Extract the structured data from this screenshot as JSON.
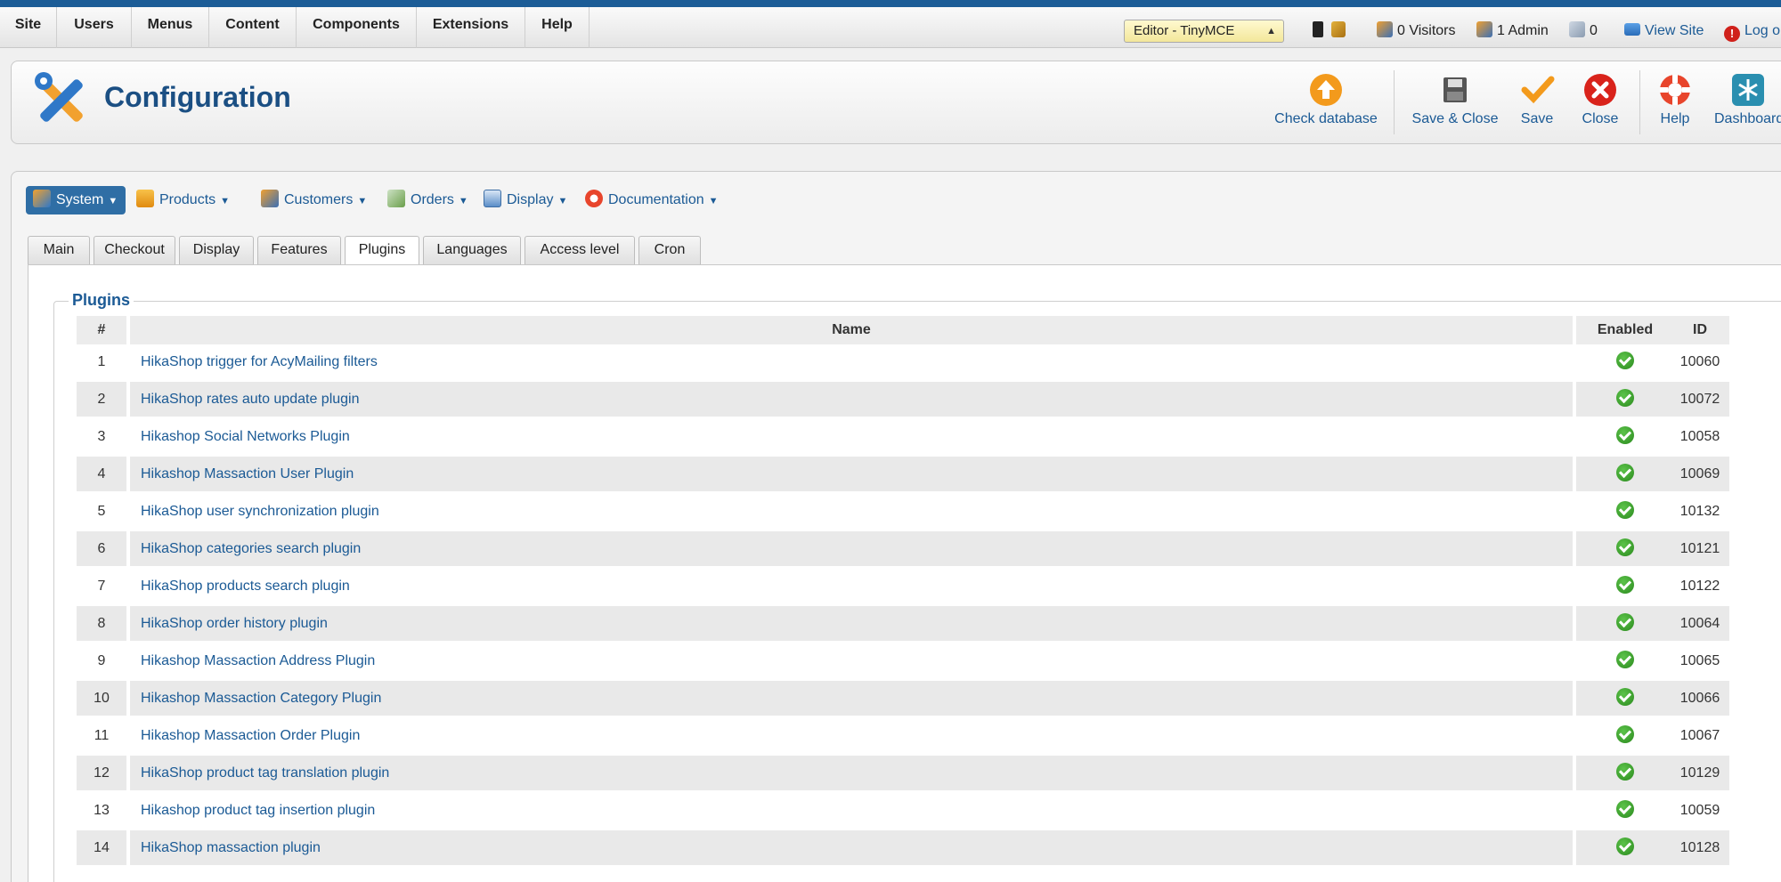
{
  "menubar": {
    "items": [
      "Site",
      "Users",
      "Menus",
      "Content",
      "Components",
      "Extensions",
      "Help"
    ],
    "editor": "Editor - TinyMCE",
    "visitors": "0 Visitors",
    "admins": "1 Admin",
    "messages": "0",
    "view_site": "View Site",
    "logout": "Log out"
  },
  "header": {
    "title": "Configuration",
    "toolbar": {
      "check_database": "Check database",
      "save_close": "Save & Close",
      "save": "Save",
      "close": "Close",
      "help": "Help",
      "dashboard": "Dashboard"
    }
  },
  "submenu": {
    "system": "System",
    "products": "Products",
    "customers": "Customers",
    "orders": "Orders",
    "display": "Display",
    "documentation": "Documentation"
  },
  "tabs": [
    "Main",
    "Checkout",
    "Display",
    "Features",
    "Plugins",
    "Languages",
    "Access level",
    "Cron"
  ],
  "active_tab": "Plugins",
  "plugins": {
    "legend": "Plugins",
    "columns": {
      "num": "#",
      "name": "Name",
      "enabled": "Enabled",
      "id": "ID"
    },
    "rows": [
      {
        "num": "1",
        "name": "HikaShop trigger for AcyMailing filters",
        "id": "10060"
      },
      {
        "num": "2",
        "name": "HikaShop rates auto update plugin",
        "id": "10072"
      },
      {
        "num": "3",
        "name": "Hikashop Social Networks Plugin",
        "id": "10058"
      },
      {
        "num": "4",
        "name": "Hikashop Massaction User Plugin",
        "id": "10069"
      },
      {
        "num": "5",
        "name": "HikaShop user synchronization plugin",
        "id": "10132"
      },
      {
        "num": "6",
        "name": "HikaShop categories search plugin",
        "id": "10121"
      },
      {
        "num": "7",
        "name": "HikaShop products search plugin",
        "id": "10122"
      },
      {
        "num": "8",
        "name": "HikaShop order history plugin",
        "id": "10064"
      },
      {
        "num": "9",
        "name": "Hikashop Massaction Address Plugin",
        "id": "10065"
      },
      {
        "num": "10",
        "name": "Hikashop Massaction Category Plugin",
        "id": "10066"
      },
      {
        "num": "11",
        "name": "Hikashop Massaction Order Plugin",
        "id": "10067"
      },
      {
        "num": "12",
        "name": "HikaShop product tag translation plugin",
        "id": "10129"
      },
      {
        "num": "13",
        "name": "Hikashop product tag insertion plugin",
        "id": "10059"
      },
      {
        "num": "14",
        "name": "HikaShop massaction plugin",
        "id": "10128"
      }
    ]
  },
  "colors": {
    "brand_blue": "#1b5a95",
    "enabled_green": "#2b8a1e"
  }
}
